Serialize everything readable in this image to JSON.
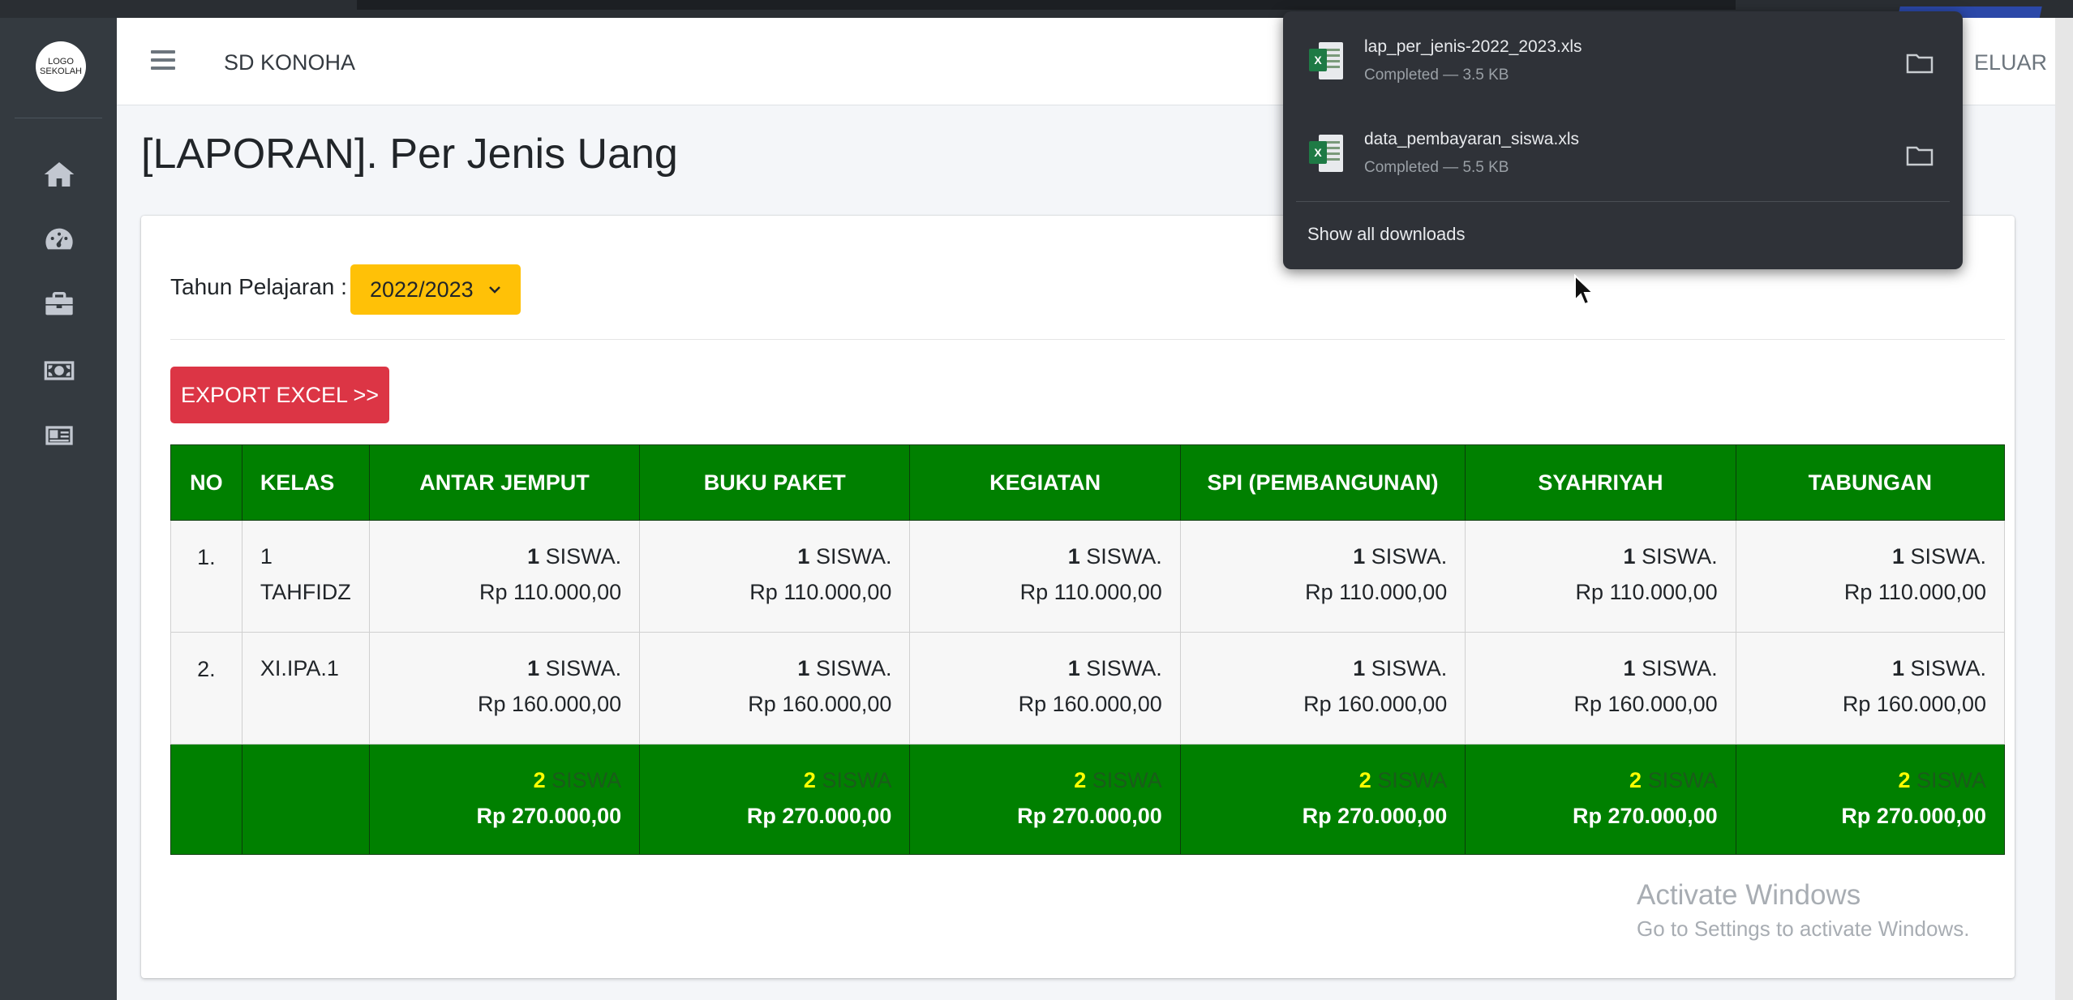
{
  "sidebar": {
    "logo_line1": "LOGO",
    "logo_line2": "SEKOLAH",
    "icons": [
      "home-icon",
      "dashboard-icon",
      "briefcase-icon",
      "money-icon",
      "id-card-icon"
    ]
  },
  "navbar": {
    "school_name": "SD KONOHA",
    "logout_label": "ELUAR"
  },
  "page": {
    "title": "[LAPORAN]. Per Jenis Uang",
    "filter_label": "Tahun Pelajaran :",
    "year_value": "2022/2023",
    "export_label": "EXPORT EXCEL >>"
  },
  "table": {
    "headers": [
      "NO",
      "KELAS",
      "ANTAR JEMPUT",
      "BUKU PAKET",
      "KEGIATAN",
      "SPI (PEMBANGUNAN)",
      "SYAHRIYAH",
      "TABUNGAN"
    ],
    "rows": [
      {
        "no": "1.",
        "kelas_line1": "1",
        "kelas_line2": "TAHFIDZ",
        "cells": [
          {
            "count": "1",
            "unit": "SISWA.",
            "amount": "Rp 110.000,00"
          },
          {
            "count": "1",
            "unit": "SISWA.",
            "amount": "Rp 110.000,00"
          },
          {
            "count": "1",
            "unit": "SISWA.",
            "amount": "Rp 110.000,00"
          },
          {
            "count": "1",
            "unit": "SISWA.",
            "amount": "Rp 110.000,00"
          },
          {
            "count": "1",
            "unit": "SISWA.",
            "amount": "Rp 110.000,00"
          },
          {
            "count": "1",
            "unit": "SISWA.",
            "amount": "Rp 110.000,00"
          }
        ]
      },
      {
        "no": "2.",
        "kelas_line1": "XI.IPA.1",
        "kelas_line2": "",
        "cells": [
          {
            "count": "1",
            "unit": "SISWA.",
            "amount": "Rp 160.000,00"
          },
          {
            "count": "1",
            "unit": "SISWA.",
            "amount": "Rp 160.000,00"
          },
          {
            "count": "1",
            "unit": "SISWA.",
            "amount": "Rp 160.000,00"
          },
          {
            "count": "1",
            "unit": "SISWA.",
            "amount": "Rp 160.000,00"
          },
          {
            "count": "1",
            "unit": "SISWA.",
            "amount": "Rp 160.000,00"
          },
          {
            "count": "1",
            "unit": "SISWA.",
            "amount": "Rp 160.000,00"
          }
        ]
      }
    ],
    "totals": [
      {
        "count": "2",
        "unit": "SISWA",
        "amount": "Rp 270.000,00"
      },
      {
        "count": "2",
        "unit": "SISWA",
        "amount": "Rp 270.000,00"
      },
      {
        "count": "2",
        "unit": "SISWA",
        "amount": "Rp 270.000,00"
      },
      {
        "count": "2",
        "unit": "SISWA",
        "amount": "Rp 270.000,00"
      },
      {
        "count": "2",
        "unit": "SISWA",
        "amount": "Rp 270.000,00"
      },
      {
        "count": "2",
        "unit": "SISWA",
        "amount": "Rp 270.000,00"
      }
    ]
  },
  "downloads": {
    "items": [
      {
        "name": "lap_per_jenis-2022_2023.xls",
        "status": "Completed — 3.5 KB"
      },
      {
        "name": "data_pembayaran_siswa.xls",
        "status": "Completed — 5.5 KB"
      }
    ],
    "show_all": "Show all downloads"
  },
  "watermark": {
    "line1": "Activate Windows",
    "line2": "Go to Settings to activate Windows."
  },
  "colors": {
    "header_green": "#008000",
    "year_select": "#ffc107",
    "export_red": "#dc3545",
    "sidebar": "#343a40"
  }
}
